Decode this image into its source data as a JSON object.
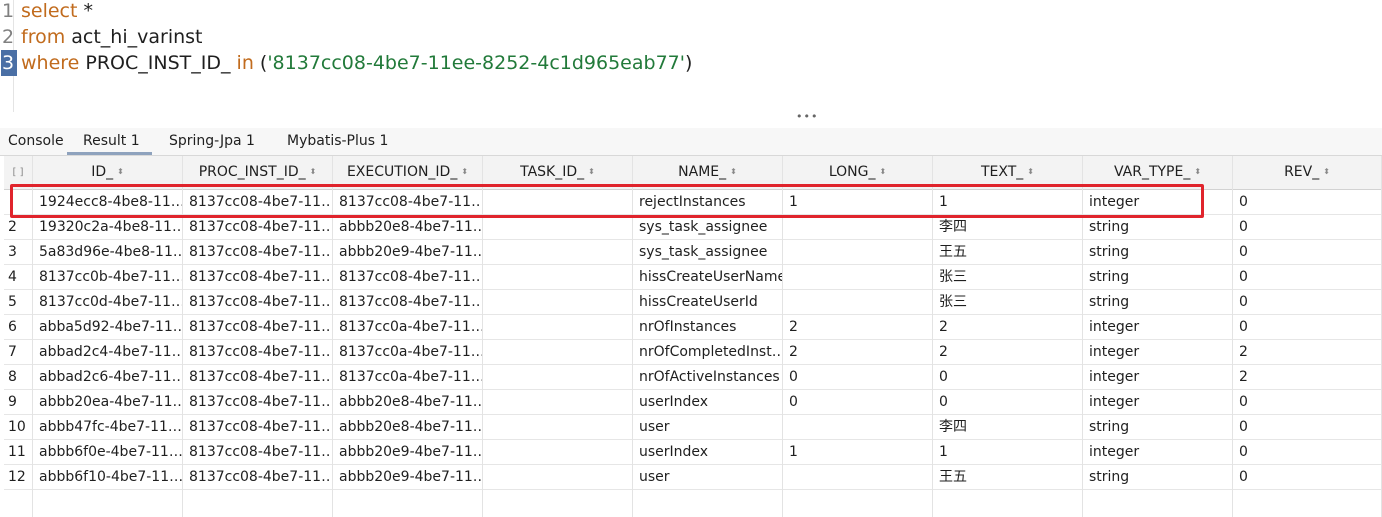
{
  "editor": {
    "lines": [
      {
        "num": "1",
        "tokens": [
          {
            "t": "select",
            "c": "kw"
          },
          {
            "t": " *",
            "c": "plain"
          }
        ]
      },
      {
        "num": "2",
        "tokens": [
          {
            "t": "from",
            "c": "kw"
          },
          {
            "t": " act_hi_varinst",
            "c": "plain"
          }
        ]
      },
      {
        "num": "3",
        "tokens": [
          {
            "t": "where",
            "c": "kw"
          },
          {
            "t": " PROC_INST_ID_ ",
            "c": "plain"
          },
          {
            "t": "in",
            "c": "kw"
          },
          {
            "t": " (",
            "c": "plain"
          },
          {
            "t": "'8137cc08-4be7-11ee-8252-4c1d965eab77'",
            "c": "str"
          },
          {
            "t": ")",
            "c": "plain"
          }
        ]
      }
    ]
  },
  "splitter_dots": "•••",
  "tabs": [
    "Console",
    "Result 1",
    "Spring-Jpa 1",
    "Mybatis-Plus 1"
  ],
  "active_tab": "Result 1",
  "grid": {
    "corner_icon": "select-all-icon",
    "columns": [
      "ID_",
      "PROC_INST_ID_",
      "EXECUTION_ID_",
      "TASK_ID_",
      "NAME_",
      "LONG_",
      "TEXT_",
      "VAR_TYPE_",
      "REV_"
    ],
    "rows": [
      {
        "num": "",
        "cells": [
          "1924ecc8-4be8-11…",
          "8137cc08-4be7-11…",
          "8137cc08-4be7-11…",
          "",
          "rejectInstances",
          "1",
          "1",
          "integer",
          "0"
        ]
      },
      {
        "num": "2",
        "cells": [
          "19320c2a-4be8-11…",
          "8137cc08-4be7-11…",
          "abbb20e8-4be7-11…",
          "",
          "sys_task_assignee",
          "",
          "李四",
          "string",
          "0"
        ]
      },
      {
        "num": "3",
        "cells": [
          "5a83d96e-4be8-11…",
          "8137cc08-4be7-11…",
          "abbb20e9-4be7-11…",
          "",
          "sys_task_assignee",
          "",
          "王五",
          "string",
          "0"
        ]
      },
      {
        "num": "4",
        "cells": [
          "8137cc0b-4be7-11…",
          "8137cc08-4be7-11…",
          "8137cc08-4be7-11…",
          "",
          "hissCreateUserName",
          "",
          "张三",
          "string",
          "0"
        ]
      },
      {
        "num": "5",
        "cells": [
          "8137cc0d-4be7-11…",
          "8137cc08-4be7-11…",
          "8137cc08-4be7-11…",
          "",
          "hissCreateUserId",
          "",
          "张三",
          "string",
          "0"
        ]
      },
      {
        "num": "6",
        "cells": [
          "abba5d92-4be7-11…",
          "8137cc08-4be7-11…",
          "8137cc0a-4be7-11…",
          "",
          "nrOfInstances",
          "2",
          "2",
          "integer",
          "0"
        ]
      },
      {
        "num": "7",
        "cells": [
          "abbad2c4-4be7-11…",
          "8137cc08-4be7-11…",
          "8137cc0a-4be7-11…",
          "",
          "nrOfCompletedInst…",
          "2",
          "2",
          "integer",
          "2"
        ]
      },
      {
        "num": "8",
        "cells": [
          "abbad2c6-4be7-11…",
          "8137cc08-4be7-11…",
          "8137cc0a-4be7-11…",
          "",
          "nrOfActiveInstances",
          "0",
          "0",
          "integer",
          "2"
        ]
      },
      {
        "num": "9",
        "cells": [
          "abbb20ea-4be7-11…",
          "8137cc08-4be7-11…",
          "abbb20e8-4be7-11…",
          "",
          "userIndex",
          "0",
          "0",
          "integer",
          "0"
        ]
      },
      {
        "num": "10",
        "cells": [
          "abbb47fc-4be7-11…",
          "8137cc08-4be7-11…",
          "abbb20e8-4be7-11…",
          "",
          "user",
          "",
          "李四",
          "string",
          "0"
        ]
      },
      {
        "num": "11",
        "cells": [
          "abbb6f0e-4be7-11…",
          "8137cc08-4be7-11…",
          "abbb20e9-4be7-11…",
          "",
          "userIndex",
          "1",
          "1",
          "integer",
          "0"
        ]
      },
      {
        "num": "12",
        "cells": [
          "abbb6f10-4be7-11…",
          "8137cc08-4be7-11…",
          "abbb20e9-4be7-11…",
          "",
          "user",
          "",
          "王五",
          "string",
          "0"
        ]
      }
    ]
  },
  "colors": {
    "keyword": "#c16b1d",
    "string": "#227a3a",
    "highlight_box": "#e0242c",
    "current_line": "#4a6fa5"
  }
}
